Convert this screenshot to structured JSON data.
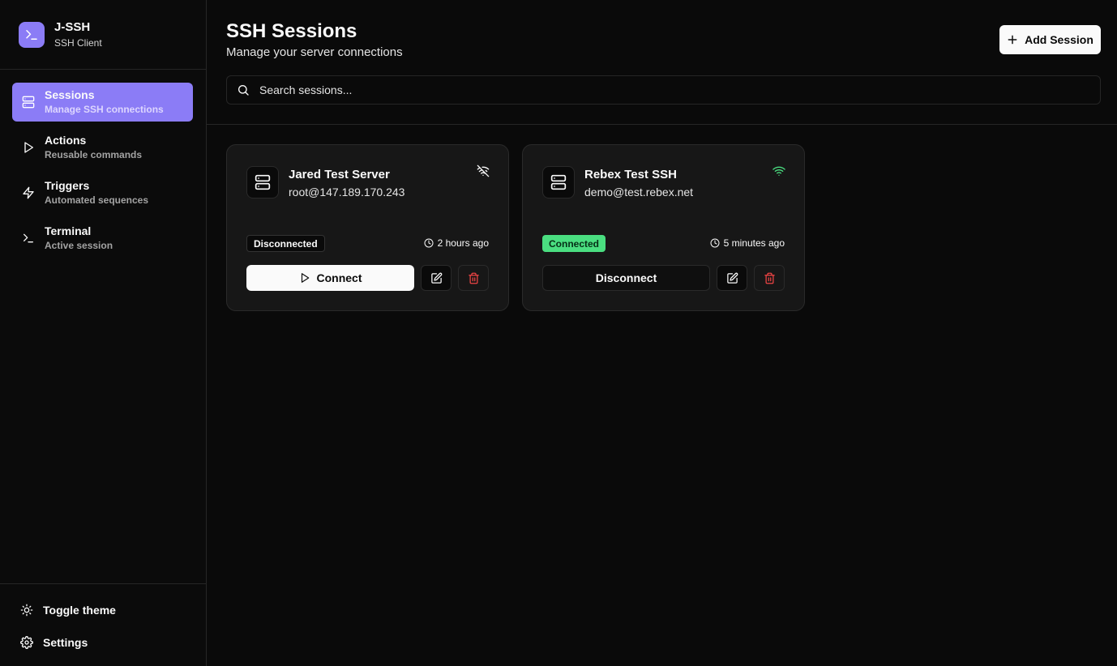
{
  "app": {
    "title": "J-SSH",
    "subtitle": "SSH Client",
    "logo_glyph": ">_"
  },
  "sidebar": {
    "items": [
      {
        "label": "Sessions",
        "sub": "Manage SSH connections",
        "icon": "server-icon",
        "active": true
      },
      {
        "label": "Actions",
        "sub": "Reusable commands",
        "icon": "play-icon",
        "active": false
      },
      {
        "label": "Triggers",
        "sub": "Automated sequences",
        "icon": "lightning-icon",
        "active": false
      },
      {
        "label": "Terminal",
        "sub": "Active session",
        "icon": "terminal-icon",
        "active": false
      }
    ],
    "footer": {
      "toggle_theme": "Toggle theme",
      "settings": "Settings"
    }
  },
  "header": {
    "title": "SSH Sessions",
    "subtitle": "Manage your server connections",
    "add_button": "Add Session"
  },
  "search": {
    "placeholder": "Search sessions...",
    "value": ""
  },
  "sessions": [
    {
      "name": "Jared Test Server",
      "host": "root@147.189.170.243",
      "status": "Disconnected",
      "status_icon": "wifi-off-icon",
      "time": "2 hours ago",
      "action": "Connect"
    },
    {
      "name": "Rebex Test SSH",
      "host": "demo@test.rebex.net",
      "status": "Connected",
      "status_icon": "wifi-icon",
      "time": "5 minutes ago",
      "action": "Disconnect"
    }
  ],
  "colors": {
    "accent": "#8b7cf6",
    "background": "#0a0a0a",
    "card": "#171717",
    "connected": "#4ade80",
    "danger": "#ef4444"
  }
}
